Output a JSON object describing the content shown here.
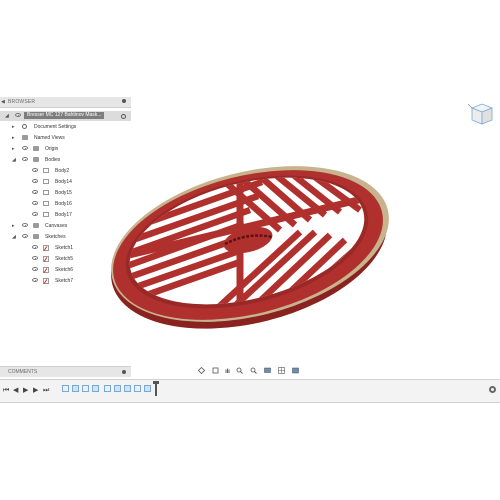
{
  "browser": {
    "title": "BROWSER",
    "root": "Bresser MC 127 Bahtinov Mask...",
    "items": [
      {
        "label": "Document Settings"
      },
      {
        "label": "Named Views"
      },
      {
        "label": "Origin"
      },
      {
        "label": "Bodies"
      },
      {
        "label": "Body2"
      },
      {
        "label": "Body14"
      },
      {
        "label": "Body15"
      },
      {
        "label": "Body16"
      },
      {
        "label": "Body17"
      },
      {
        "label": "Canvases"
      },
      {
        "label": "Sketches"
      },
      {
        "label": "Sketch1"
      },
      {
        "label": "Sketch5"
      },
      {
        "label": "Sketch6"
      },
      {
        "label": "Sketch7"
      }
    ]
  },
  "comments": {
    "title": "COMMENTS"
  },
  "model": {
    "color": "#b0302d",
    "rim_color": "#c8b38f",
    "shadow_color": "#8a2220"
  },
  "nav_toolbar": {
    "icons": [
      "orbit-icon",
      "look-at-icon",
      "pan-icon",
      "zoom-icon",
      "fit-icon",
      "display-settings-icon",
      "grid-settings-icon",
      "viewports-icon"
    ]
  },
  "timeline": {
    "controls": [
      "go-to-start-icon",
      "step-back-icon",
      "play-icon",
      "step-forward-icon",
      "go-to-end-icon"
    ]
  }
}
